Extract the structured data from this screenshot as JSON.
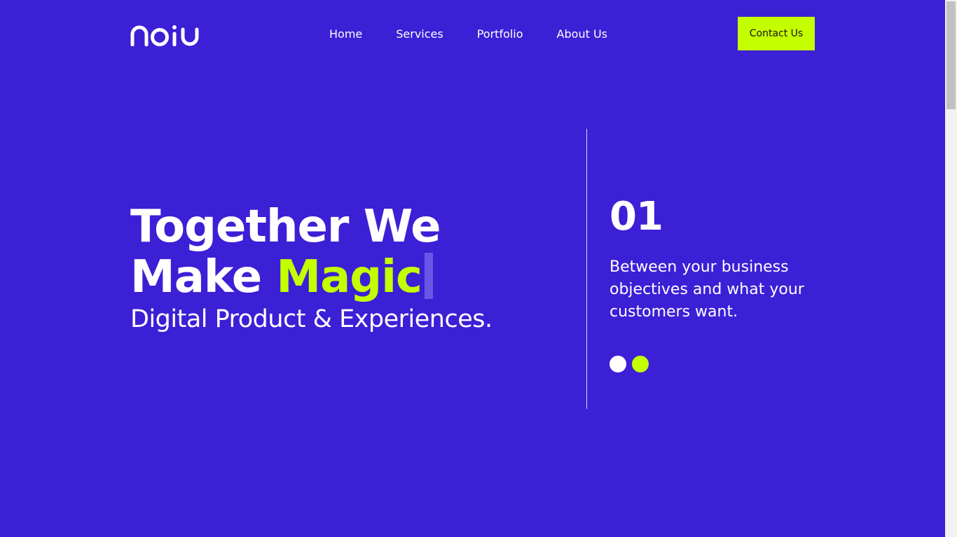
{
  "brand": {
    "logo_text": "noiu"
  },
  "nav": {
    "items": [
      {
        "label": "Home"
      },
      {
        "label": "Services"
      },
      {
        "label": "Portfolio"
      },
      {
        "label": "About Us"
      }
    ],
    "contact_label": "Contact Us"
  },
  "hero": {
    "line1": "Together We",
    "line2_prefix": "Make ",
    "line2_accent": "Magic",
    "subtitle": "Digital Product & Experiences."
  },
  "slide": {
    "number": "01",
    "text": "Between your business objectives and what your customers want.",
    "dots": [
      "white",
      "lime"
    ]
  },
  "colors": {
    "background": "#3b20d6",
    "accent": "#c4ff00",
    "text": "#ffffff"
  }
}
